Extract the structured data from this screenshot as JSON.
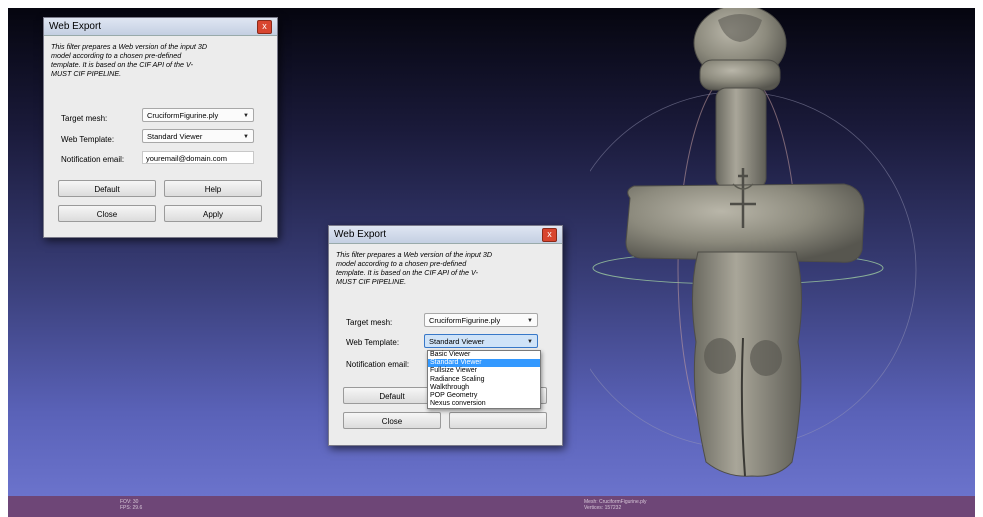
{
  "dialog_back": {
    "title": "Web Export",
    "close_glyph": "x",
    "description": [
      "This filter prepares a Web version of the input 3D",
      "model according to a chosen pre-defined",
      "template. It is based on the CIF API of the V-",
      "MUST CIF PIPELINE."
    ],
    "target_mesh_label": "Target mesh:",
    "target_mesh_value": "CruciformFigurine.ply",
    "web_template_label": "Web Template:",
    "web_template_value": "Standard Viewer",
    "email_label": "Notification email:",
    "email_value": "youremail@domain.com",
    "default_btn": "Default",
    "help_btn": "Help",
    "close_btn": "Close",
    "apply_btn": "Apply"
  },
  "dialog_front": {
    "title": "Web Export",
    "close_glyph": "x",
    "description": [
      "This filter prepares a Web version of the input 3D",
      "model according to a chosen pre-defined",
      "template. It is based on the CIF API of the V-",
      "MUST CIF PIPELINE."
    ],
    "target_mesh_label": "Target mesh:",
    "target_mesh_value": "CruciformFigurine.ply",
    "web_template_label": "Web Template:",
    "web_template_value": "Standard Viewer",
    "email_label": "Notification email:",
    "default_btn": "Default",
    "close_btn": "Close",
    "dropdown_options": [
      "Basic Viewer",
      "Standard Viewer",
      "Fullsize Viewer",
      "Radiance Scaling",
      "Walkthrough",
      "POP Geometry",
      "Nexus conversion"
    ],
    "dropdown_selected": "Standard Viewer"
  },
  "statusbar": {
    "left_line1": "FOV: 30",
    "left_line2": "FPS:   29.6",
    "right_line1": "Mesh: CruciformFigurine.ply",
    "right_line2": "Vertices: 157232"
  },
  "colors": {
    "viewport_top": "#04040c",
    "viewport_bottom": "#6b73cc",
    "statusbar": "#6e4677",
    "selection": "#3399ff"
  },
  "icons": {
    "figurine": "cruciform-figurine-3d-model",
    "trackball": "trackball-sphere"
  }
}
